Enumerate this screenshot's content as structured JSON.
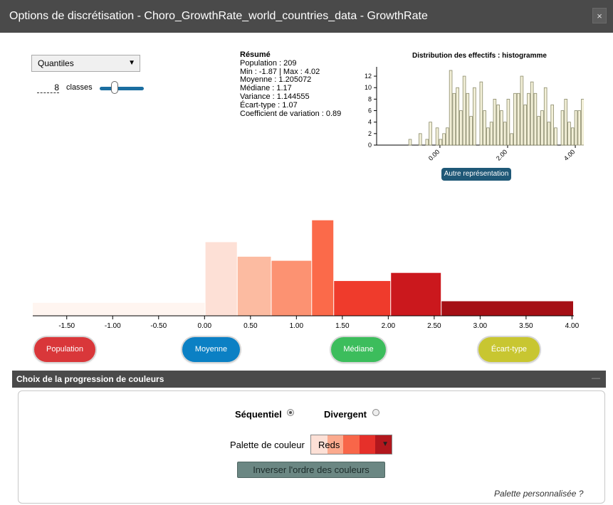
{
  "window": {
    "title": "Options de discrétisation - Choro_GrowthRate_world_countries_data - GrowthRate",
    "close_glyph": "×"
  },
  "method": {
    "selected": "Quantiles"
  },
  "classes": {
    "value": "8",
    "label": "classes",
    "slider_fraction": 0.35
  },
  "summary": {
    "heading": "Résumé",
    "lines": [
      "Population : 209",
      "Min : -1.87 | Max : 4.02",
      "Moyenne : 1.205072",
      "Médiane : 1.17",
      "Variance : 1.144555",
      "Écart-type : 1.07",
      "Coefficient de variation : 0.89"
    ]
  },
  "histogram": {
    "title": "Distribution des effectifs : histogramme",
    "button": "Autre représentation"
  },
  "buttons": {
    "population": "Population",
    "moyenne": "Moyenne",
    "mediane": "Médiane",
    "ecart_type": "Écart-type"
  },
  "colors": {
    "population": "#d9373a",
    "moyenne": "#0b80c4",
    "mediane": "#3cbd5c",
    "ecart_type": "#c8c631"
  },
  "section": {
    "title": "Choix de la progression de couleurs",
    "collapse": "—"
  },
  "options": {
    "sequentiel": "Séquentiel",
    "divergent": "Divergent"
  },
  "palette": {
    "label": "Palette de couleur",
    "name": "Reds",
    "swatches": [
      "#fde0d6",
      "#fbaa8e",
      "#f86649",
      "#e6302a",
      "#b2171d"
    ]
  },
  "invert_button": "Inverser l'ordre des couleurs",
  "custom_palette": "Palette personnalisée ?",
  "chart_data": [
    {
      "type": "bar",
      "title": "Distribution des effectifs : histogramme",
      "xlim": [
        -1.87,
        4.02
      ],
      "ylim": [
        0,
        13
      ],
      "yticks": [
        0,
        2,
        4,
        6,
        8,
        10,
        12
      ],
      "xticks": [
        "0.00",
        "2.00",
        "4.00"
      ],
      "xtick_values": [
        0,
        2,
        4
      ],
      "values": [
        1,
        0,
        0,
        2,
        0,
        1,
        4,
        0,
        3,
        1,
        2,
        3,
        13,
        9,
        10,
        6,
        12,
        9,
        5,
        10,
        0,
        11,
        6,
        3,
        4,
        8,
        7,
        6,
        4,
        8,
        2,
        9,
        9,
        12,
        7,
        9,
        11,
        9,
        5,
        6,
        10,
        4,
        7,
        3,
        0,
        6,
        8,
        4,
        3,
        6,
        6,
        8,
        5,
        10,
        4,
        5,
        8,
        7,
        5,
        5,
        1,
        0,
        0,
        6,
        8,
        4,
        6,
        1,
        0,
        0,
        1,
        0,
        0,
        1,
        0,
        0,
        0,
        1
      ],
      "bins_start": 0.28,
      "bin_width": 0.1
    },
    {
      "type": "bar",
      "xlim": [
        -1.87,
        4.02
      ],
      "xticks": [
        "-1.50",
        "-1.00",
        "-0.50",
        "0.00",
        "0.50",
        "1.00",
        "1.50",
        "2.00",
        "2.50",
        "3.00",
        "3.50",
        "4.00"
      ],
      "xtick_values": [
        -1.5,
        -1.0,
        -0.5,
        0.0,
        0.5,
        1.0,
        1.5,
        2.0,
        2.5,
        3.0,
        3.5,
        4.0
      ],
      "breaks": [
        -1.87,
        0.01,
        0.36,
        0.73,
        1.17,
        1.41,
        2.03,
        2.58,
        4.02
      ],
      "density": [
        0.16,
        0.91,
        0.73,
        0.68,
        1.18,
        0.43,
        0.53,
        0.18
      ],
      "colors": [
        "#fff5f0",
        "#fde0d6",
        "#fcbba1",
        "#fc9272",
        "#fb6a4a",
        "#ef3b2c",
        "#cb181d",
        "#a50f15"
      ]
    }
  ]
}
